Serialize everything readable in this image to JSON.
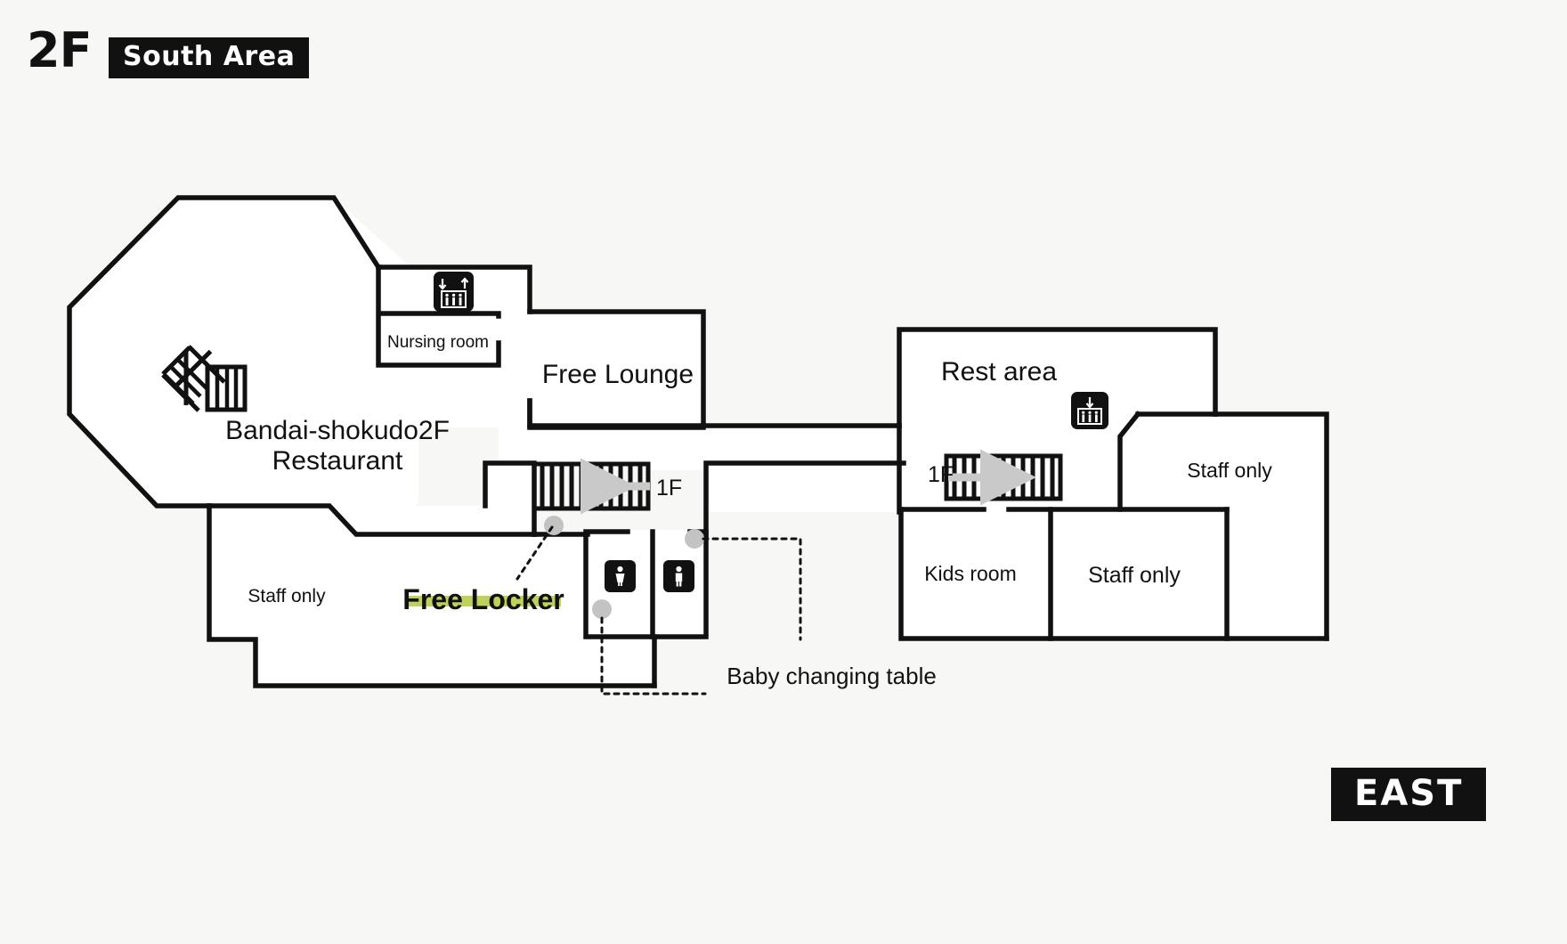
{
  "header": {
    "floor": "2F",
    "area_badge": "South Area",
    "direction_badge": "EAST"
  },
  "colors": {
    "background": "#f7f7f5",
    "wall": "#111111",
    "room_fill": "#ffffff",
    "highlight": "#bdd25c",
    "marker_dot": "#c3c3c3",
    "arrow": "#c9c9c9",
    "icon_bg": "#111111",
    "icon_fg": "#ffffff"
  },
  "rooms": [
    {
      "id": "restaurant",
      "label_line1": "Bandai-shokudo2F",
      "label_line2": "Restaurant"
    },
    {
      "id": "nursing-room",
      "label": "Nursing room"
    },
    {
      "id": "free-lounge",
      "label": "Free Lounge"
    },
    {
      "id": "rest-area",
      "label": "Rest area"
    },
    {
      "id": "staff-only-left",
      "label": "Staff only"
    },
    {
      "id": "staff-only-right-upper",
      "label": "Staff only"
    },
    {
      "id": "staff-only-right-lower",
      "label": "Staff only"
    },
    {
      "id": "kids-room",
      "label": "Kids room"
    }
  ],
  "callouts": [
    {
      "id": "free-locker",
      "label": "Free Locker",
      "highlighted": true
    },
    {
      "id": "baby-changing-table",
      "label": "Baby changing table",
      "highlighted": false
    }
  ],
  "stair_labels": {
    "left": "1F",
    "right": "1F"
  },
  "icons": [
    {
      "id": "elevator-left",
      "name": "elevator-up-down-icon",
      "arrows": "down-up"
    },
    {
      "id": "elevator-right",
      "name": "elevator-down-icon",
      "arrows": "down"
    },
    {
      "id": "toilet-women",
      "name": "toilet-women-icon"
    },
    {
      "id": "toilet-men",
      "name": "toilet-men-icon"
    },
    {
      "id": "stairs-restaurant",
      "name": "stairs-icon"
    },
    {
      "id": "stairs-left",
      "name": "stairs-icon"
    },
    {
      "id": "stairs-right",
      "name": "stairs-icon"
    }
  ]
}
